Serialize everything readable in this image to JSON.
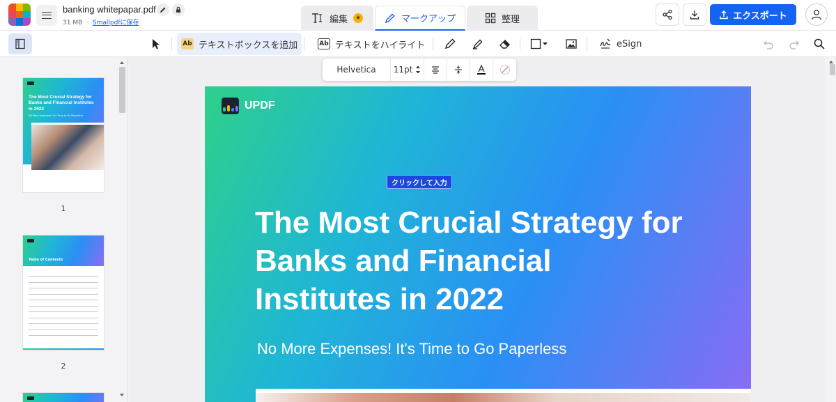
{
  "app": {
    "file_name": "banking whitepapar.pdf",
    "file_size": "31 MB",
    "meta_separator": "·",
    "save_link": "Smallpdfに保存",
    "logo_colors": [
      "#f25022",
      "#ffb900",
      "#7fba00",
      "#e74856",
      "#f7630c",
      "#00b7c3",
      "#8764b8",
      "#0078d4",
      "#b146c2"
    ]
  },
  "mode_tabs": [
    {
      "label": "編集",
      "icon": "text-edit-icon",
      "badge": "★"
    },
    {
      "label": "マークアップ",
      "icon": "pencil-icon"
    },
    {
      "label": "整理",
      "icon": "grid-icon"
    }
  ],
  "header_actions": {
    "share_icon": "share-icon",
    "download_icon": "download-icon",
    "export_label": "エクスポート",
    "avatar_icon": "user-icon"
  },
  "toolbar": {
    "add_textbox_badge": "Ab",
    "add_textbox": "テキストボックスを追加",
    "highlight_text_badge": "Ab",
    "highlight_text": "テキストをハイライト",
    "esign": "eSign"
  },
  "format_bar": {
    "font": "Helvetica",
    "size": "11pt"
  },
  "thumbnails": [
    {
      "page": "1",
      "title": "The Most Crucial Strategy for Banks and Financial Institutes in 2022",
      "subtitle": "No More Expenses! It's Time to Go Paperless"
    },
    {
      "page": "2",
      "title": "Table of Contents"
    }
  ],
  "document": {
    "brand": "UPDF",
    "click_tag": "クリックして入力",
    "headline": "The Most Crucial Strategy for Banks and Financial Institutes in 2022",
    "subline": "No More Expenses! It's Time to Go Paperless"
  }
}
